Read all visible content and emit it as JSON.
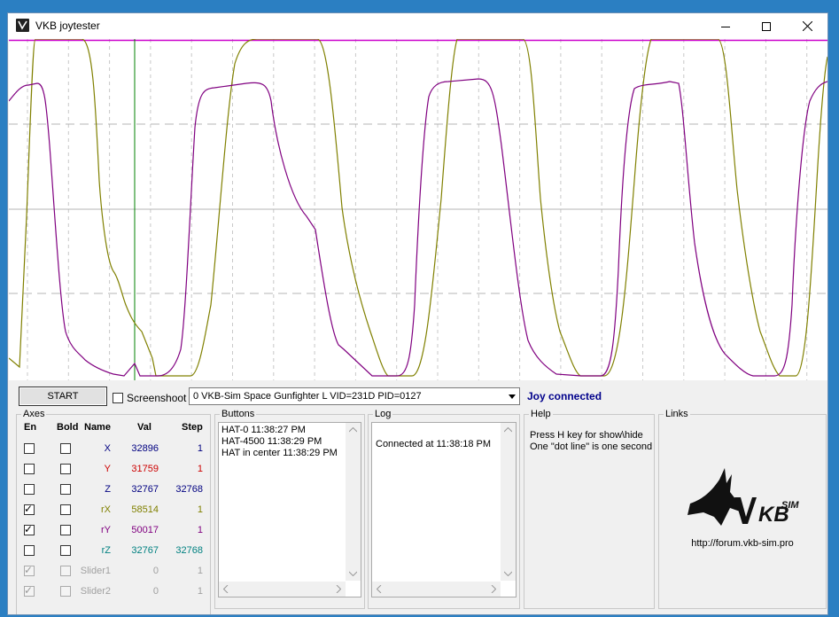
{
  "window": {
    "title": "VKB joytester"
  },
  "toolbar": {
    "start_label": "START",
    "screenshot_label": "Screenshoot",
    "device_value": "0  VKB-Sim Space Gunfighter L  VID=231D PID=0127",
    "status": "Joy connected"
  },
  "axes": {
    "title": "Axes",
    "headers": {
      "en": "En",
      "bold": "Bold",
      "name": "Name",
      "val": "Val",
      "step": "Step"
    },
    "rows": [
      {
        "name": "X",
        "val": "32896",
        "step": "1",
        "color": "#000080",
        "en": false,
        "bold": false,
        "disabled": false
      },
      {
        "name": "Y",
        "val": "31759",
        "step": "1",
        "color": "#cc0000",
        "en": false,
        "bold": false,
        "disabled": false
      },
      {
        "name": "Z",
        "val": "32767",
        "step": "32768",
        "color": "#000080",
        "en": false,
        "bold": false,
        "disabled": false
      },
      {
        "name": "rX",
        "val": "58514",
        "step": "1",
        "color": "#808000",
        "en": true,
        "bold": false,
        "disabled": false
      },
      {
        "name": "rY",
        "val": "50017",
        "step": "1",
        "color": "#800080",
        "en": true,
        "bold": false,
        "disabled": false
      },
      {
        "name": "rZ",
        "val": "32767",
        "step": "32768",
        "color": "#008080",
        "en": false,
        "bold": false,
        "disabled": false
      },
      {
        "name": "Slider1",
        "val": "0",
        "step": "1",
        "color": "#a0a0a0",
        "en": true,
        "bold": false,
        "disabled": true
      },
      {
        "name": "Slider2",
        "val": "0",
        "step": "1",
        "color": "#a0a0a0",
        "en": true,
        "bold": false,
        "disabled": true
      }
    ]
  },
  "buttons": {
    "title": "Buttons",
    "lines": [
      "HAT-0 11:38:27 PM",
      "HAT-4500 11:38:29 PM",
      "HAT in center 11:38:29 PM"
    ]
  },
  "log": {
    "title": "Log",
    "lines": [
      "Connected at 11:38:18 PM"
    ]
  },
  "help": {
    "title": "Help",
    "lines": [
      "Press H key for show\\hide",
      "One \"dot line\" is one second"
    ]
  },
  "links": {
    "title": "Links",
    "logo_text": "KBSIM",
    "url": "http://forum.vkb-sim.pro"
  },
  "colors": {
    "rx_trace": "#808000",
    "ry_trace": "#800080",
    "top_line": "#cc00cc",
    "cursor": "#008000",
    "status": "#00008b"
  }
}
